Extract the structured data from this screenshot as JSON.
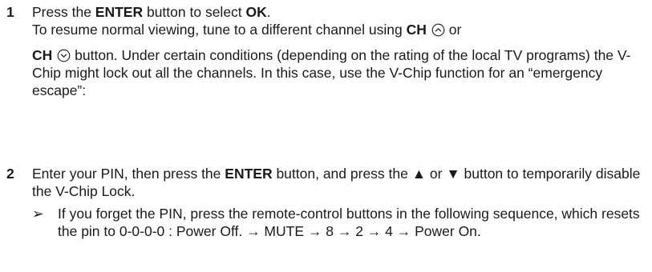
{
  "steps": [
    {
      "number": "1",
      "line1": {
        "pre": "Press the ",
        "btn": "ENTER",
        "mid": " button to select ",
        "opt": "OK",
        "post": "."
      },
      "line2": {
        "pre": "To resume normal viewing, tune to a different channel using ",
        "ch": "CH",
        "post": " or"
      },
      "line3": {
        "ch": "CH",
        "post": " button. Under certain conditions (depending on the rating of the local TV programs) the V-Chip might lock out all the channels. In this case, use the V-Chip function for an “emergency escape”:"
      }
    },
    {
      "number": "2",
      "text": {
        "pre": "Enter your PIN, then press the ",
        "btn": "ENTER",
        "post": " button, and press the ▲ or ▼ button to temporarily disable the V-Chip Lock."
      },
      "note": {
        "arrow": "➢",
        "text": "If you forget the PIN, press the remote-control buttons in the following sequence, which resets the pin to 0-0-0-0 : Power Off. → MUTE → 8 → 2 → 4 → Power On."
      }
    }
  ],
  "icons": {
    "ch_up": "chevron-up-circle-icon",
    "ch_down": "chevron-down-circle-icon"
  }
}
